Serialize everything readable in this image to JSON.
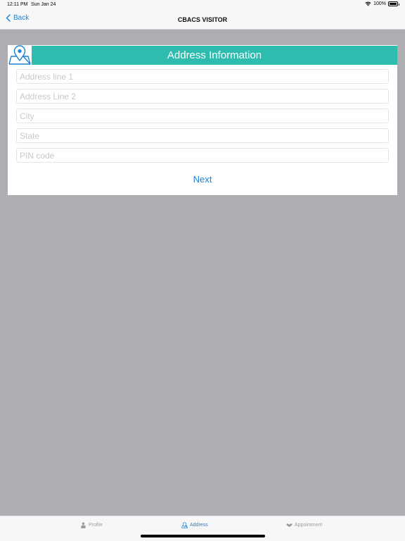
{
  "status_bar": {
    "time": "12:11 PM",
    "date": "Sun Jan 24",
    "battery": "100%"
  },
  "nav": {
    "back_label": "Back",
    "title": "CBACS VISITOR"
  },
  "card": {
    "title": "Address Information",
    "fields": {
      "address_line_1": {
        "placeholder": "Address line 1",
        "value": ""
      },
      "address_line_2": {
        "placeholder": "Address Line 2",
        "value": ""
      },
      "city": {
        "placeholder": "City",
        "value": ""
      },
      "state": {
        "placeholder": "State",
        "value": ""
      },
      "pin_code": {
        "placeholder": "PIN code",
        "value": ""
      }
    },
    "next_label": "Next"
  },
  "tabs": [
    {
      "label": "Profile",
      "icon": "person-icon",
      "active": false
    },
    {
      "label": "Address",
      "icon": "location-icon",
      "active": true
    },
    {
      "label": "Appointment",
      "icon": "handshake-icon",
      "active": false
    }
  ],
  "colors": {
    "accent": "#1a82d8",
    "header": "#2ebcae",
    "background": "#aeadb2"
  }
}
